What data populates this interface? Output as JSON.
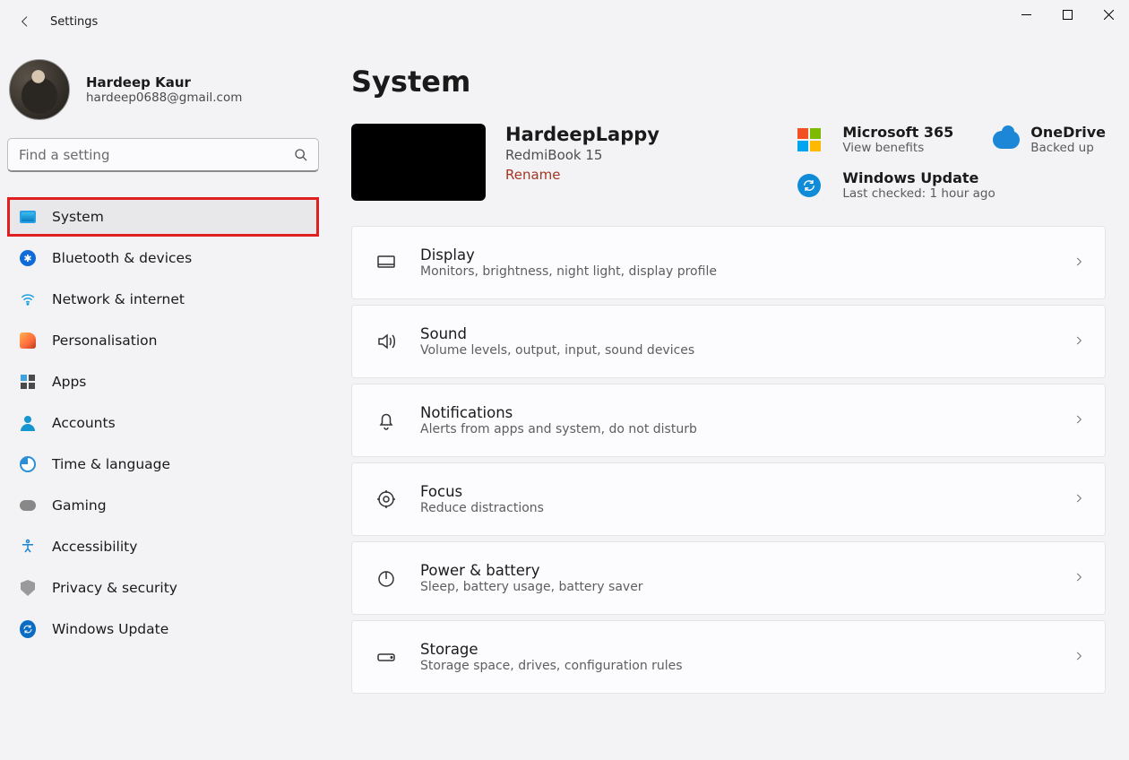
{
  "window": {
    "title": "Settings"
  },
  "user": {
    "name": "Hardeep Kaur",
    "email": "hardeep0688@gmail.com"
  },
  "search": {
    "placeholder": "Find a setting"
  },
  "nav": [
    {
      "id": "system",
      "label": "System",
      "selected": true
    },
    {
      "id": "bluetooth",
      "label": "Bluetooth & devices"
    },
    {
      "id": "network",
      "label": "Network & internet"
    },
    {
      "id": "personalisation",
      "label": "Personalisation"
    },
    {
      "id": "apps",
      "label": "Apps"
    },
    {
      "id": "accounts",
      "label": "Accounts"
    },
    {
      "id": "time",
      "label": "Time & language"
    },
    {
      "id": "gaming",
      "label": "Gaming"
    },
    {
      "id": "accessibility",
      "label": "Accessibility"
    },
    {
      "id": "privacy",
      "label": "Privacy & security"
    },
    {
      "id": "update",
      "label": "Windows Update"
    }
  ],
  "page": {
    "heading": "System"
  },
  "device": {
    "name": "HardeepLappy",
    "model": "RedmiBook 15",
    "rename_label": "Rename"
  },
  "promo": {
    "ms365": {
      "title": "Microsoft 365",
      "sub": "View benefits"
    },
    "onedrive": {
      "title": "OneDrive",
      "sub": "Backed up"
    },
    "winupdate": {
      "title": "Windows Update",
      "sub": "Last checked: 1 hour ago"
    }
  },
  "settings": [
    {
      "id": "display",
      "title": "Display",
      "sub": "Monitors, brightness, night light, display profile"
    },
    {
      "id": "sound",
      "title": "Sound",
      "sub": "Volume levels, output, input, sound devices"
    },
    {
      "id": "notifications",
      "title": "Notifications",
      "sub": "Alerts from apps and system, do not disturb"
    },
    {
      "id": "focus",
      "title": "Focus",
      "sub": "Reduce distractions"
    },
    {
      "id": "power",
      "title": "Power & battery",
      "sub": "Sleep, battery usage, battery saver"
    },
    {
      "id": "storage",
      "title": "Storage",
      "sub": "Storage space, drives, configuration rules"
    }
  ]
}
